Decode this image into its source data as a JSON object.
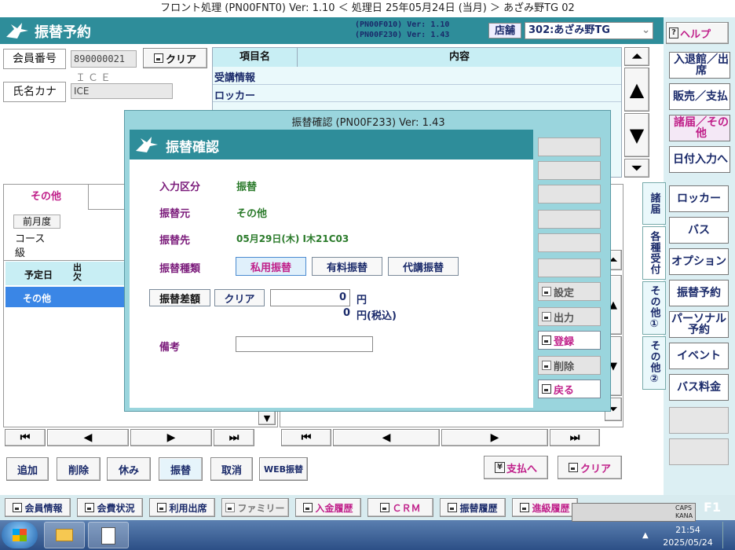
{
  "window_title": "フロント処理 (PN00FNT0) Ver: 1.10 ＜ 処理日 25年05月24日 (当月) ＞ あざみ野TG 02",
  "screen_title": "振替予約",
  "version_lines": [
    "(PN00F010) Ver: 1.10",
    "(PN00F230) Ver: 1.43"
  ],
  "store_label": "店舗",
  "store_value": "302:あざみ野TG",
  "help_label": "ヘルプ",
  "member": {
    "no_label": "会員番号",
    "no_value": "890000021",
    "clear": "クリア",
    "name_sub": "ＩＣＥ",
    "kana_label": "氏名カナ",
    "kana_value": "ICE"
  },
  "info_table": {
    "col1": "項目名",
    "col2": "内容",
    "rows": [
      "受講情報",
      "ロッカー"
    ]
  },
  "right_menu": [
    "入退館／出席",
    "販売／支払",
    "諸届／その他",
    "日付入力へ"
  ],
  "side_tabs": [
    "諸届",
    "各種受付",
    "その他①",
    "その他②"
  ],
  "side_buttons": [
    "ロッカー",
    "バス",
    "オプション",
    "振替予約",
    "パーソナル予約",
    "イベント",
    "バス料金"
  ],
  "left_panel": {
    "tab": "その他",
    "prev_year": "前月度",
    "course": "コース",
    "grade": "級",
    "col_date": "予定日",
    "col_att": "出欠",
    "row1": "その他"
  },
  "bottom_buttons": [
    "追加",
    "削除",
    "休み",
    "振替",
    "取消",
    "WEB振替"
  ],
  "pay_button": "支払へ",
  "clear_button": "クリア",
  "footer_buttons": [
    "会員情報",
    "会費状況",
    "利用出席",
    "ファミリー",
    "入金履歴",
    "ＣＲＭ",
    "振替履歴",
    "進級履歴"
  ],
  "dialog": {
    "title": "振替確認 (PN00F233) Ver: 1.43",
    "header": "振替確認",
    "fields": [
      {
        "label": "入力区分",
        "value": "振替"
      },
      {
        "label": "振替元",
        "value": "その他"
      },
      {
        "label": "振替先",
        "value": "05月29日(木) I木21C03"
      }
    ],
    "type_label": "振替種類",
    "types": [
      "私用振替",
      "有料振替",
      "代講振替"
    ],
    "diff_label": "振替差額",
    "diff_clear": "クリア",
    "amount": "0",
    "yen": "円",
    "amount_tax": "0",
    "yen_tax": "円(税込)",
    "memo_label": "備考",
    "side_buttons": [
      "設定",
      "出力",
      "登録",
      "削除",
      "戻る"
    ]
  },
  "taskbar": {
    "time": "21:54",
    "date": "2025/05/24",
    "f1": "F1",
    "caps": "CAPS",
    "kana": "KANA"
  }
}
